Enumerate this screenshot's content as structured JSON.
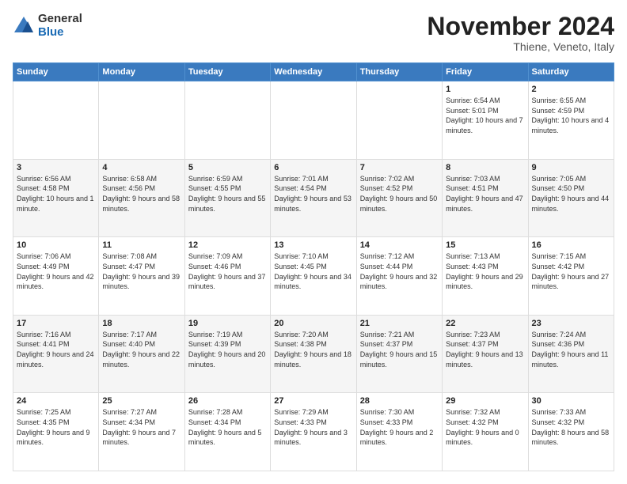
{
  "logo": {
    "general": "General",
    "blue": "Blue"
  },
  "header": {
    "month_title": "November 2024",
    "location": "Thiene, Veneto, Italy"
  },
  "days_of_week": [
    "Sunday",
    "Monday",
    "Tuesday",
    "Wednesday",
    "Thursday",
    "Friday",
    "Saturday"
  ],
  "weeks": [
    [
      {
        "day": "",
        "info": ""
      },
      {
        "day": "",
        "info": ""
      },
      {
        "day": "",
        "info": ""
      },
      {
        "day": "",
        "info": ""
      },
      {
        "day": "",
        "info": ""
      },
      {
        "day": "1",
        "info": "Sunrise: 6:54 AM\nSunset: 5:01 PM\nDaylight: 10 hours and 7 minutes."
      },
      {
        "day": "2",
        "info": "Sunrise: 6:55 AM\nSunset: 4:59 PM\nDaylight: 10 hours and 4 minutes."
      }
    ],
    [
      {
        "day": "3",
        "info": "Sunrise: 6:56 AM\nSunset: 4:58 PM\nDaylight: 10 hours and 1 minute."
      },
      {
        "day": "4",
        "info": "Sunrise: 6:58 AM\nSunset: 4:56 PM\nDaylight: 9 hours and 58 minutes."
      },
      {
        "day": "5",
        "info": "Sunrise: 6:59 AM\nSunset: 4:55 PM\nDaylight: 9 hours and 55 minutes."
      },
      {
        "day": "6",
        "info": "Sunrise: 7:01 AM\nSunset: 4:54 PM\nDaylight: 9 hours and 53 minutes."
      },
      {
        "day": "7",
        "info": "Sunrise: 7:02 AM\nSunset: 4:52 PM\nDaylight: 9 hours and 50 minutes."
      },
      {
        "day": "8",
        "info": "Sunrise: 7:03 AM\nSunset: 4:51 PM\nDaylight: 9 hours and 47 minutes."
      },
      {
        "day": "9",
        "info": "Sunrise: 7:05 AM\nSunset: 4:50 PM\nDaylight: 9 hours and 44 minutes."
      }
    ],
    [
      {
        "day": "10",
        "info": "Sunrise: 7:06 AM\nSunset: 4:49 PM\nDaylight: 9 hours and 42 minutes."
      },
      {
        "day": "11",
        "info": "Sunrise: 7:08 AM\nSunset: 4:47 PM\nDaylight: 9 hours and 39 minutes."
      },
      {
        "day": "12",
        "info": "Sunrise: 7:09 AM\nSunset: 4:46 PM\nDaylight: 9 hours and 37 minutes."
      },
      {
        "day": "13",
        "info": "Sunrise: 7:10 AM\nSunset: 4:45 PM\nDaylight: 9 hours and 34 minutes."
      },
      {
        "day": "14",
        "info": "Sunrise: 7:12 AM\nSunset: 4:44 PM\nDaylight: 9 hours and 32 minutes."
      },
      {
        "day": "15",
        "info": "Sunrise: 7:13 AM\nSunset: 4:43 PM\nDaylight: 9 hours and 29 minutes."
      },
      {
        "day": "16",
        "info": "Sunrise: 7:15 AM\nSunset: 4:42 PM\nDaylight: 9 hours and 27 minutes."
      }
    ],
    [
      {
        "day": "17",
        "info": "Sunrise: 7:16 AM\nSunset: 4:41 PM\nDaylight: 9 hours and 24 minutes."
      },
      {
        "day": "18",
        "info": "Sunrise: 7:17 AM\nSunset: 4:40 PM\nDaylight: 9 hours and 22 minutes."
      },
      {
        "day": "19",
        "info": "Sunrise: 7:19 AM\nSunset: 4:39 PM\nDaylight: 9 hours and 20 minutes."
      },
      {
        "day": "20",
        "info": "Sunrise: 7:20 AM\nSunset: 4:38 PM\nDaylight: 9 hours and 18 minutes."
      },
      {
        "day": "21",
        "info": "Sunrise: 7:21 AM\nSunset: 4:37 PM\nDaylight: 9 hours and 15 minutes."
      },
      {
        "day": "22",
        "info": "Sunrise: 7:23 AM\nSunset: 4:37 PM\nDaylight: 9 hours and 13 minutes."
      },
      {
        "day": "23",
        "info": "Sunrise: 7:24 AM\nSunset: 4:36 PM\nDaylight: 9 hours and 11 minutes."
      }
    ],
    [
      {
        "day": "24",
        "info": "Sunrise: 7:25 AM\nSunset: 4:35 PM\nDaylight: 9 hours and 9 minutes."
      },
      {
        "day": "25",
        "info": "Sunrise: 7:27 AM\nSunset: 4:34 PM\nDaylight: 9 hours and 7 minutes."
      },
      {
        "day": "26",
        "info": "Sunrise: 7:28 AM\nSunset: 4:34 PM\nDaylight: 9 hours and 5 minutes."
      },
      {
        "day": "27",
        "info": "Sunrise: 7:29 AM\nSunset: 4:33 PM\nDaylight: 9 hours and 3 minutes."
      },
      {
        "day": "28",
        "info": "Sunrise: 7:30 AM\nSunset: 4:33 PM\nDaylight: 9 hours and 2 minutes."
      },
      {
        "day": "29",
        "info": "Sunrise: 7:32 AM\nSunset: 4:32 PM\nDaylight: 9 hours and 0 minutes."
      },
      {
        "day": "30",
        "info": "Sunrise: 7:33 AM\nSunset: 4:32 PM\nDaylight: 8 hours and 58 minutes."
      }
    ]
  ]
}
